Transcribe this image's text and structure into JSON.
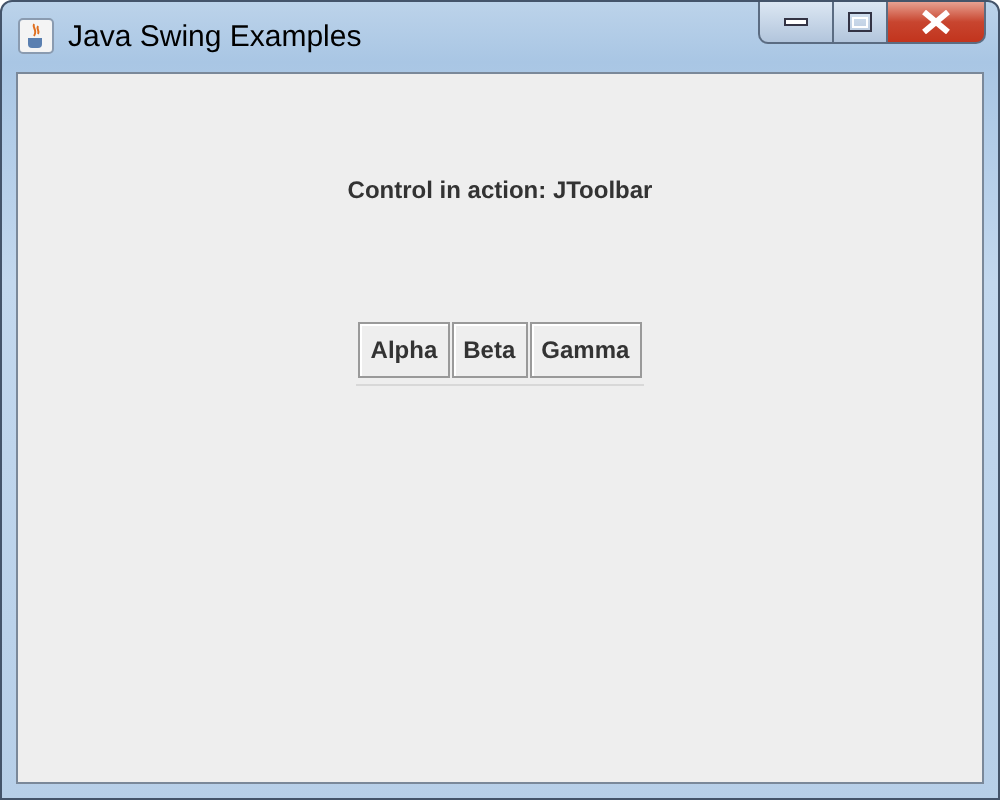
{
  "window": {
    "title": "Java Swing Examples"
  },
  "label": "Control in action: JToolbar",
  "toolbar": {
    "buttons": [
      {
        "label": "Alpha"
      },
      {
        "label": "Beta"
      },
      {
        "label": "Gamma"
      }
    ]
  }
}
